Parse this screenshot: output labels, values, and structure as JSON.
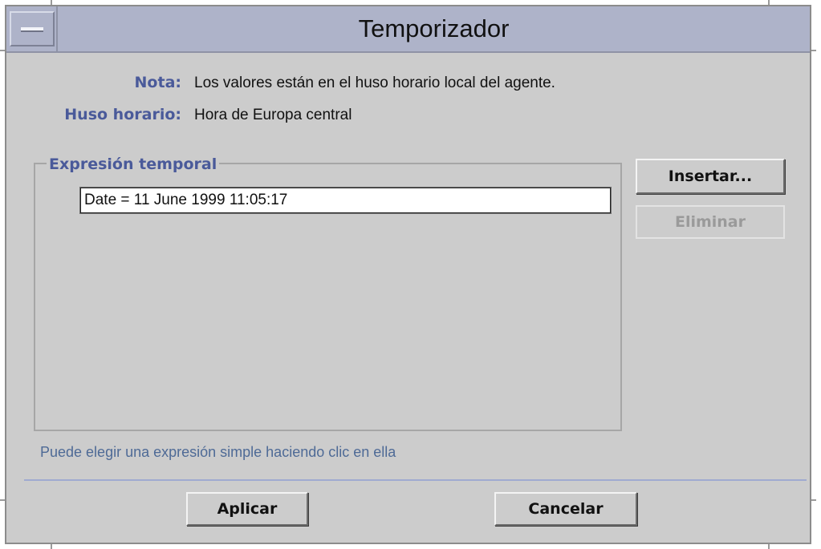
{
  "window": {
    "title": "Temporizador",
    "menu_icon": "window-menu-icon"
  },
  "note": {
    "label": "Nota:",
    "value": "Los valores están en el huso horario local del agente."
  },
  "timezone": {
    "label": "Huso horario:",
    "value": "Hora de Europa central"
  },
  "expression_group": {
    "title": "Expresión temporal",
    "items": [
      "Date = 11 June 1999 11:05:17"
    ],
    "insert_label": "Insertar...",
    "delete_label": "Eliminar"
  },
  "hint": "Puede elegir una expresión simple haciendo clic en ella",
  "footer": {
    "apply_label": "Aplicar",
    "cancel_label": "Cancelar"
  },
  "colors": {
    "titlebar": "#aeb3c9",
    "panel": "#cccccc",
    "label_accent": "#4a5a9a",
    "hint": "#4e6a96"
  }
}
